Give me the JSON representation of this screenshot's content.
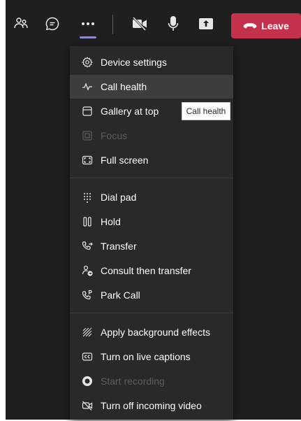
{
  "toolbar": {
    "leave_label": "Leave",
    "icons": [
      "people-icon",
      "chat-icon",
      "more-icon",
      "camera-off-icon",
      "mic-icon",
      "share-icon",
      "phone-hangup-icon"
    ],
    "accent": "#c4314b",
    "active_indicator": "#8b8cc7"
  },
  "menu": {
    "items": [
      {
        "label": "Device settings",
        "icon": "gear-icon"
      },
      {
        "label": "Call health",
        "icon": "pulse-icon",
        "hovered": true
      },
      {
        "label": "Gallery at top",
        "icon": "gallery-icon"
      },
      {
        "label": "Focus",
        "icon": "focus-icon",
        "disabled": true
      },
      {
        "label": "Full screen",
        "icon": "fullscreen-icon"
      },
      {
        "label": "Dial pad",
        "icon": "dialpad-icon"
      },
      {
        "label": "Hold",
        "icon": "pause-icon"
      },
      {
        "label": "Transfer",
        "icon": "transfer-icon"
      },
      {
        "label": "Consult then transfer",
        "icon": "consult-transfer-icon"
      },
      {
        "label": "Park Call",
        "icon": "park-call-icon"
      },
      {
        "label": "Apply background effects",
        "icon": "background-effects-icon"
      },
      {
        "label": "Turn on live captions",
        "icon": "captions-icon"
      },
      {
        "label": "Start recording",
        "icon": "record-icon",
        "disabled": true
      },
      {
        "label": "Turn off incoming video",
        "icon": "video-off-icon"
      }
    ]
  },
  "tooltip": {
    "text": "Call health"
  }
}
